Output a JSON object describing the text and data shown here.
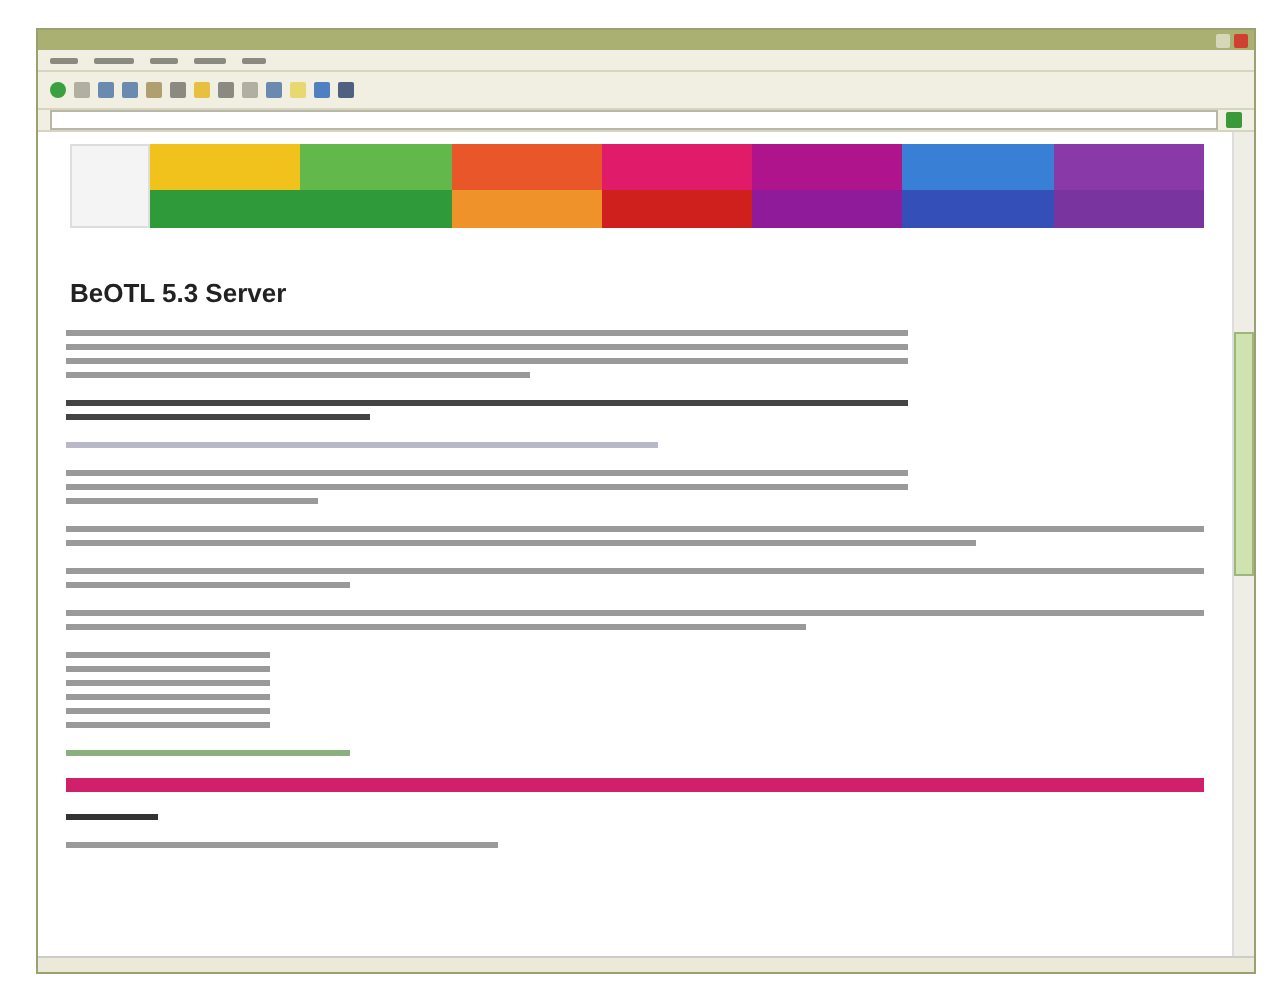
{
  "page": {
    "heading": "BeOTL 5.3 Server"
  },
  "banner": {
    "top": [
      {
        "color": "#f2c21c"
      },
      {
        "color": "#62b84a"
      },
      {
        "color": "#e8562a"
      },
      {
        "color": "#e01b6a"
      },
      {
        "color": "#b0148c"
      },
      {
        "color": "#3a7fd6"
      },
      {
        "color": "#8a3aa8"
      }
    ],
    "bottom": [
      {
        "color": "#2f9a3a"
      },
      {
        "color": "#2f9a3a"
      },
      {
        "color": "#f0922a"
      },
      {
        "color": "#d0201e"
      },
      {
        "color": "#8f1a9a"
      },
      {
        "color": "#3450b8"
      },
      {
        "color": "#7a34a0"
      }
    ]
  }
}
